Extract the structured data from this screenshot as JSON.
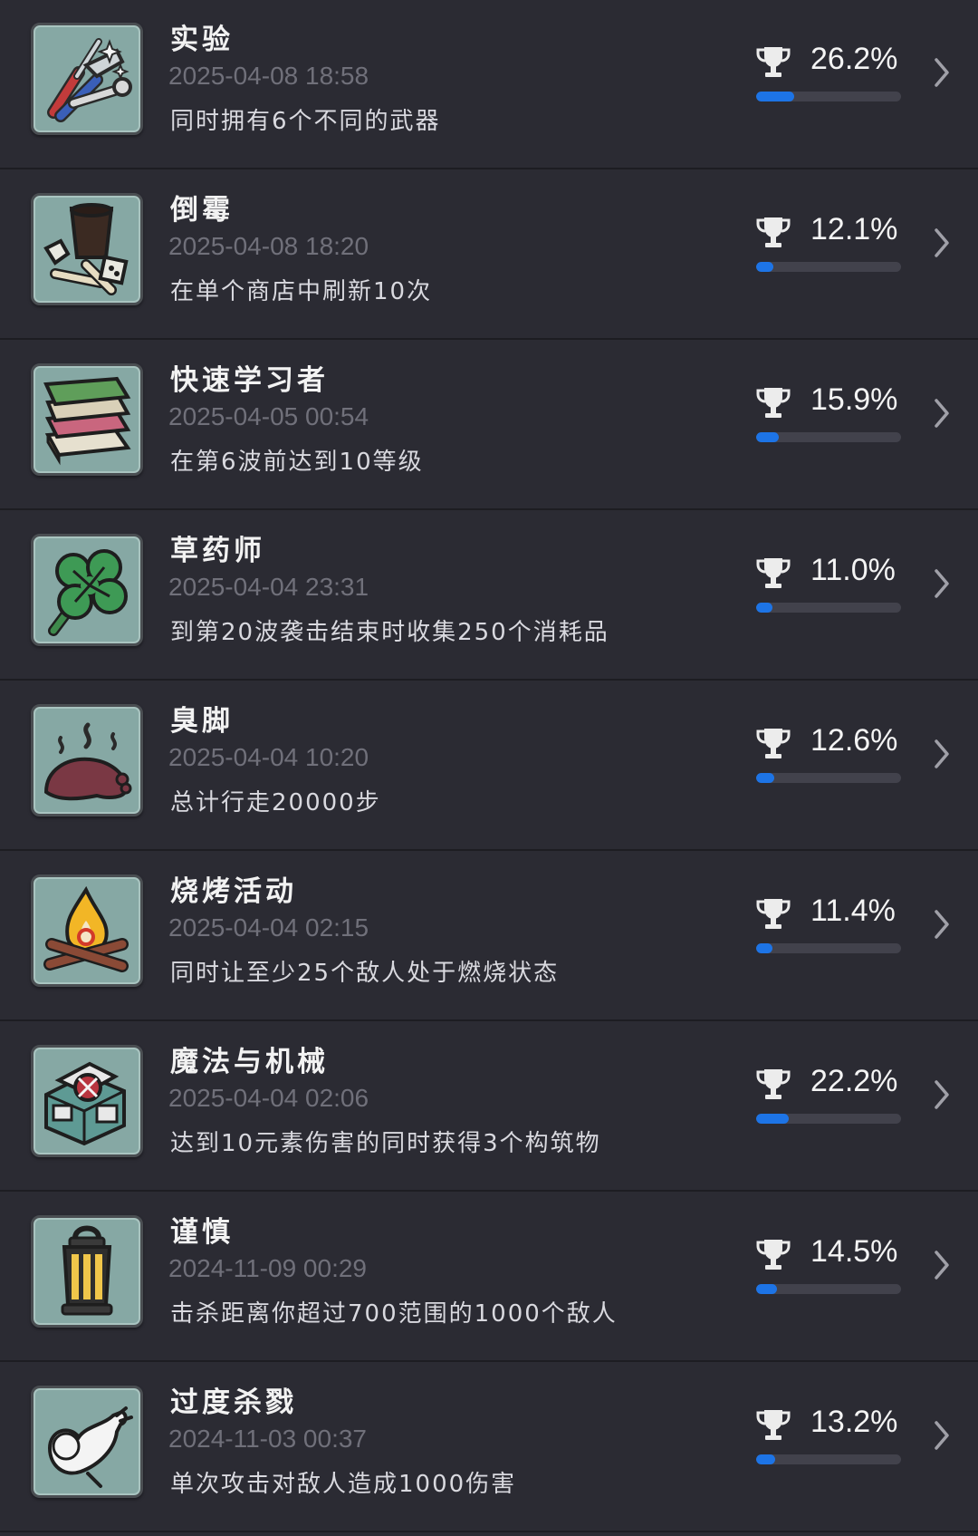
{
  "achievements": [
    {
      "title": "实验",
      "date": "2025-04-08 18:58",
      "description": "同时拥有6个不同的武器",
      "percent_label": "26.2%",
      "percent": 26.2,
      "icon": "tools-icon"
    },
    {
      "title": "倒霉",
      "date": "2025-04-08 18:20",
      "description": "在单个商店中刷新10次",
      "percent_label": "12.1%",
      "percent": 12.1,
      "icon": "bucket-bones-dice-icon"
    },
    {
      "title": "快速学习者",
      "date": "2025-04-05 00:54",
      "description": "在第6波前达到10等级",
      "percent_label": "15.9%",
      "percent": 15.9,
      "icon": "books-icon"
    },
    {
      "title": "草药师",
      "date": "2025-04-04 23:31",
      "description": "到第20波袭击结束时收集250个消耗品",
      "percent_label": "11.0%",
      "percent": 11.0,
      "icon": "clover-icon"
    },
    {
      "title": "臭脚",
      "date": "2025-04-04 10:20",
      "description": "总计行走20000步",
      "percent_label": "12.6%",
      "percent": 12.6,
      "icon": "smelly-foot-icon"
    },
    {
      "title": "烧烤活动",
      "date": "2025-04-04 02:15",
      "description": "同时让至少25个敌人处于燃烧状态",
      "percent_label": "11.4%",
      "percent": 11.4,
      "icon": "campfire-icon"
    },
    {
      "title": "魔法与机械",
      "date": "2025-04-04 02:06",
      "description": "达到10元素伤害的同时获得3个构筑物",
      "percent_label": "22.2%",
      "percent": 22.2,
      "icon": "magic-machine-icon"
    },
    {
      "title": "谨慎",
      "date": "2024-11-09 00:29",
      "description": "击杀距离你超过700范围的1000个敌人",
      "percent_label": "14.5%",
      "percent": 14.5,
      "icon": "lantern-icon"
    },
    {
      "title": "过度杀戮",
      "date": "2024-11-03 00:37",
      "description": "单次攻击对敌人造成1000伤害",
      "percent_label": "13.2%",
      "percent": 13.2,
      "icon": "flexing-arm-icon"
    }
  ],
  "colors": {
    "background": "#2b2b33",
    "accent": "#1d74e6",
    "bar_track": "#42424c",
    "icon_tile": "#86a8a4"
  }
}
